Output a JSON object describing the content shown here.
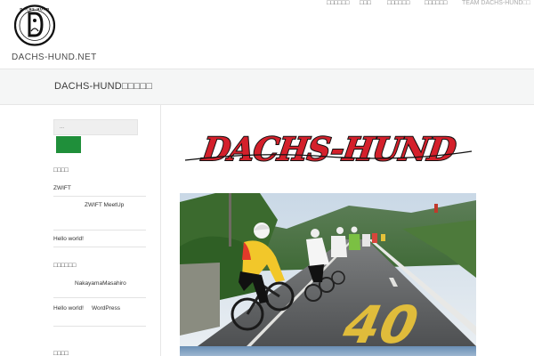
{
  "header": {
    "site_title": "DACHS-HUND.NET",
    "logo_text": "DACHS-HUND",
    "nav": [
      {
        "label": "□□□□□□",
        "active": false
      },
      {
        "label": "□□□",
        "active": false
      },
      {
        "label": "□□□□□□",
        "active": false
      },
      {
        "label": "□□□□□□",
        "active": false
      },
      {
        "label": "TEAM DACHS-HUND□□",
        "active": true
      }
    ]
  },
  "band": {
    "title": "DACHS-HUND□□□□□"
  },
  "sidebar": {
    "search_placeholder": "...",
    "heading_1": "□□□□",
    "item_zwift": "ZWIFT",
    "item_zwift_meetup": "ZWIFT  MeetUp",
    "item_hello_1": "Hello world!",
    "heading_2": "□□□□□□",
    "item_author": "NakayamaMasahiro",
    "item_hello_2": "Hello world!",
    "item_wordpress": "WordPress",
    "heading_3": "□□□□"
  },
  "content": {
    "banner_text": "DACHS-HUND",
    "road_text": "40"
  },
  "colors": {
    "accent_green": "#1f8f3a",
    "banner_red": "#d4202b",
    "band_bg": "#f5f6f6"
  }
}
